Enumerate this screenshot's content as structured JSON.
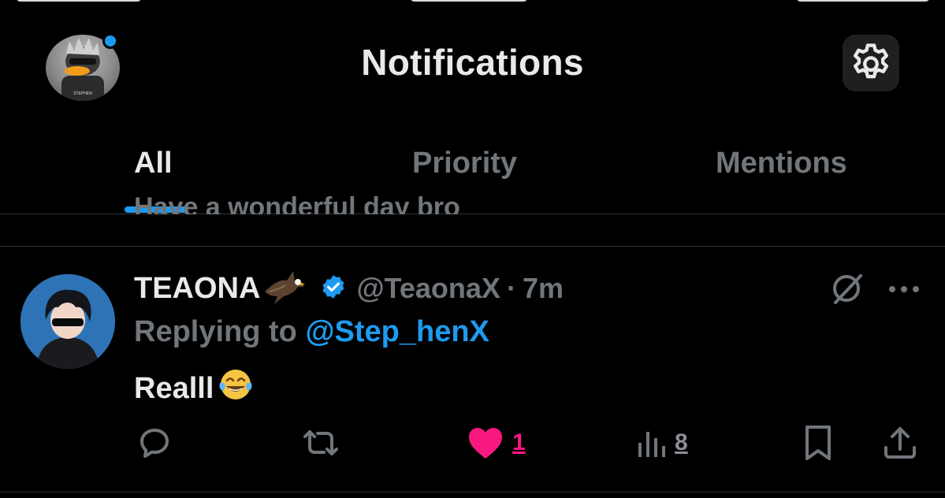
{
  "header": {
    "title": "Notifications",
    "avatar_icon": "profile-avatar-duck",
    "settings_icon": "gear-icon"
  },
  "tabs": [
    {
      "label": "All",
      "active": true
    },
    {
      "label": "Priority",
      "active": false
    },
    {
      "label": "Mentions",
      "active": false
    }
  ],
  "previous_item": {
    "text": "Have a wonderful day bro"
  },
  "tweet": {
    "display_name": "TEAONA",
    "name_emoji": "eagle",
    "verified": true,
    "handle": "@TeaonaX",
    "separator": "·",
    "time": "7m",
    "replying_prefix": "Replying to ",
    "replying_to": "@Step_henX",
    "text": "Realll",
    "text_emoji": "face-with-tears-of-joy",
    "actions": {
      "reply": {
        "icon": "reply-icon"
      },
      "retweet": {
        "icon": "retweet-icon"
      },
      "like": {
        "icon": "heart-icon",
        "count": "1",
        "liked": true
      },
      "views": {
        "icon": "views-icon",
        "count": "8"
      },
      "bookmark": {
        "icon": "bookmark-icon"
      },
      "share": {
        "icon": "share-icon"
      }
    }
  },
  "colors": {
    "background": "#000000",
    "accent": "#1d9bf0",
    "like": "#f91880",
    "muted": "#71767b",
    "text": "#e7e9ea"
  }
}
